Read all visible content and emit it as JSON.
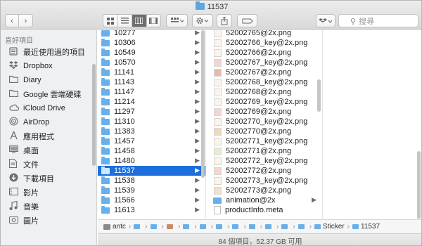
{
  "window": {
    "title": "11537"
  },
  "toolbar": {
    "back_icon": "‹",
    "forward_icon": "›",
    "search_placeholder": "搜尋"
  },
  "sidebar": {
    "heading": "喜好項目",
    "items": [
      {
        "label": "最近使用過的項目",
        "icon": "recents-icon"
      },
      {
        "label": "Dropbox",
        "icon": "dropbox-icon"
      },
      {
        "label": "Diary",
        "icon": "folder-icon"
      },
      {
        "label": "Google 雲端硬碟",
        "icon": "folder-icon"
      },
      {
        "label": "iCloud Drive",
        "icon": "cloud-icon"
      },
      {
        "label": "AirDrop",
        "icon": "airdrop-icon"
      },
      {
        "label": "應用程式",
        "icon": "applications-icon"
      },
      {
        "label": "桌面",
        "icon": "desktop-icon"
      },
      {
        "label": "文件",
        "icon": "documents-icon"
      },
      {
        "label": "下載項目",
        "icon": "downloads-icon"
      },
      {
        "label": "影片",
        "icon": "movies-icon"
      },
      {
        "label": "音樂",
        "icon": "music-icon"
      },
      {
        "label": "圖片",
        "icon": "pictures-icon"
      }
    ]
  },
  "column1": {
    "items": [
      "10277",
      "10306",
      "10549",
      "10570",
      "11141",
      "11143",
      "11147",
      "11214",
      "11297",
      "11310",
      "11383",
      "11457",
      "11458",
      "11480",
      "11537",
      "11538",
      "11539",
      "11566",
      "11613"
    ],
    "selected_index": 14
  },
  "column2": {
    "items": [
      {
        "name": "52002765@2x.png",
        "kind": "image"
      },
      {
        "name": "52002766_key@2x.png",
        "kind": "image"
      },
      {
        "name": "52002766@2x.png",
        "kind": "image"
      },
      {
        "name": "52002767_key@2x.png",
        "kind": "image"
      },
      {
        "name": "52002767@2x.png",
        "kind": "image"
      },
      {
        "name": "52002768_key@2x.png",
        "kind": "image"
      },
      {
        "name": "52002768@2x.png",
        "kind": "image"
      },
      {
        "name": "52002769_key@2x.png",
        "kind": "image"
      },
      {
        "name": "52002769@2x.png",
        "kind": "image"
      },
      {
        "name": "52002770_key@2x.png",
        "kind": "image"
      },
      {
        "name": "52002770@2x.png",
        "kind": "image"
      },
      {
        "name": "52002771_key@2x.png",
        "kind": "image"
      },
      {
        "name": "52002771@2x.png",
        "kind": "image"
      },
      {
        "name": "52002772_key@2x.png",
        "kind": "image"
      },
      {
        "name": "52002772@2x.png",
        "kind": "image"
      },
      {
        "name": "52002773_key@2x.png",
        "kind": "image"
      },
      {
        "name": "52002773@2x.png",
        "kind": "image"
      },
      {
        "name": "animation@2x",
        "kind": "folder"
      },
      {
        "name": "productInfo.meta",
        "kind": "document"
      }
    ]
  },
  "pathbar": {
    "segments": [
      "antc",
      "",
      "",
      "",
      "",
      "",
      "",
      "",
      "",
      "",
      "",
      "",
      "Sticker",
      "11537"
    ]
  },
  "statusbar": {
    "text": "84 個項目，52.37 GB 可用"
  }
}
